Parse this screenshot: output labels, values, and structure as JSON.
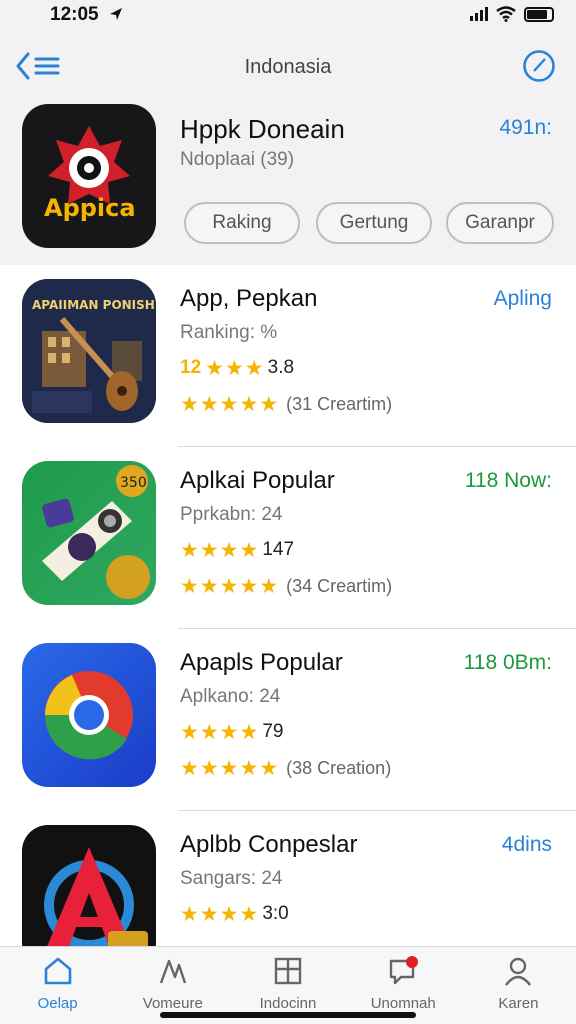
{
  "status": {
    "time": "12:05"
  },
  "nav": {
    "title": "Indonasia"
  },
  "hero": {
    "title": "Hppk Doneain",
    "subtitle": "Ndoplaai (39)",
    "badge": "491n:",
    "icon_text": "Appica",
    "pills": [
      "Raking",
      "Gertung",
      "Garanpr"
    ]
  },
  "apps": [
    {
      "name": "App, Pepkan",
      "side_label": "Apling",
      "side_color": "#2a82d8",
      "meta": "Ranking: %",
      "score_prefix": "12",
      "score_stars": 3,
      "score": "3.8",
      "stars_filled": 4.5,
      "reviews": "(31 Creartim)",
      "icon_text": "APAIIMAN PONISHN"
    },
    {
      "name": "Aplkai Popular",
      "side_label": "118 Now:",
      "side_color": "#1a9a3a",
      "meta": "Pprkabn: 24",
      "score_prefix": "",
      "score_stars": 4,
      "score": "147",
      "stars_filled": 5,
      "reviews": "(34 Creartim)",
      "icon_text": "350"
    },
    {
      "name": "Apapls Popular",
      "side_label": "118 0Bm:",
      "side_color": "#1a9a3a",
      "meta": "Aplkano: 24",
      "score_prefix": "",
      "score_stars": 4,
      "score": "79",
      "stars_filled": 5,
      "reviews": "(38 Creation)",
      "icon_text": ""
    },
    {
      "name": "Aplbb Conpeslar",
      "side_label": "4dins",
      "side_color": "#2a82d8",
      "meta": "Sangars: 24",
      "score_prefix": "",
      "score_stars": 4,
      "score": "3:0",
      "stars_filled": 0,
      "reviews": "",
      "icon_text": ""
    }
  ],
  "tabs": [
    {
      "label": "Oelap",
      "icon": "home-icon",
      "active": true
    },
    {
      "label": "Vomeure",
      "icon": "chart-icon",
      "active": false
    },
    {
      "label": "Indocinn",
      "icon": "grid-icon",
      "active": false
    },
    {
      "label": "Unomnah",
      "icon": "chat-icon",
      "active": false
    },
    {
      "label": "Karen",
      "icon": "person-icon",
      "active": false
    }
  ],
  "colors": {
    "accent": "#2a82d8",
    "star": "#f5b400",
    "green": "#1a9a3a"
  }
}
